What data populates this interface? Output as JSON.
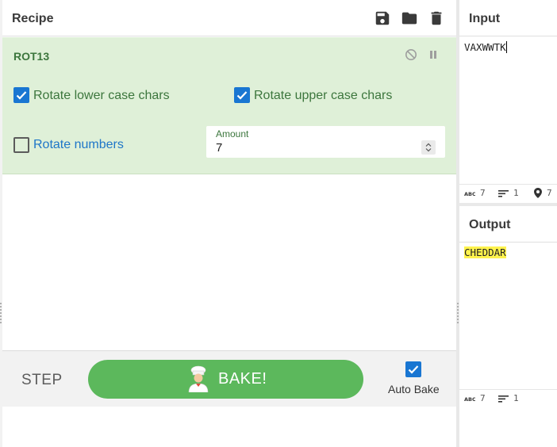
{
  "recipe": {
    "title": "Recipe",
    "icons": [
      "save-icon",
      "folder-icon",
      "trash-icon"
    ],
    "operation": {
      "name": "ROT13",
      "controls": [
        "disable-icon",
        "pause-icon"
      ],
      "options": {
        "lower": {
          "label": "Rotate lower case chars",
          "checked": true
        },
        "upper": {
          "label": "Rotate upper case chars",
          "checked": true
        },
        "numbers": {
          "label": "Rotate numbers",
          "checked": false
        }
      },
      "amount": {
        "label": "Amount",
        "value": "7"
      }
    },
    "controls": {
      "step_label": "STEP",
      "bake_label": "BAKE!",
      "auto_bake_label": "Auto Bake",
      "auto_bake_checked": true
    }
  },
  "input": {
    "title": "Input",
    "text": "VAXWWTK",
    "status": {
      "chars": "7",
      "lines": "1",
      "position": "7"
    }
  },
  "output": {
    "title": "Output",
    "text": "CHEDDAR",
    "status": {
      "chars": "7",
      "lines": "1"
    }
  },
  "colors": {
    "operation_bg": "#dff0d8",
    "operation_text": "#3c763d",
    "checkbox_blue": "#1976d2",
    "bake_green": "#5cb85c",
    "highlight": "#fff34d"
  }
}
